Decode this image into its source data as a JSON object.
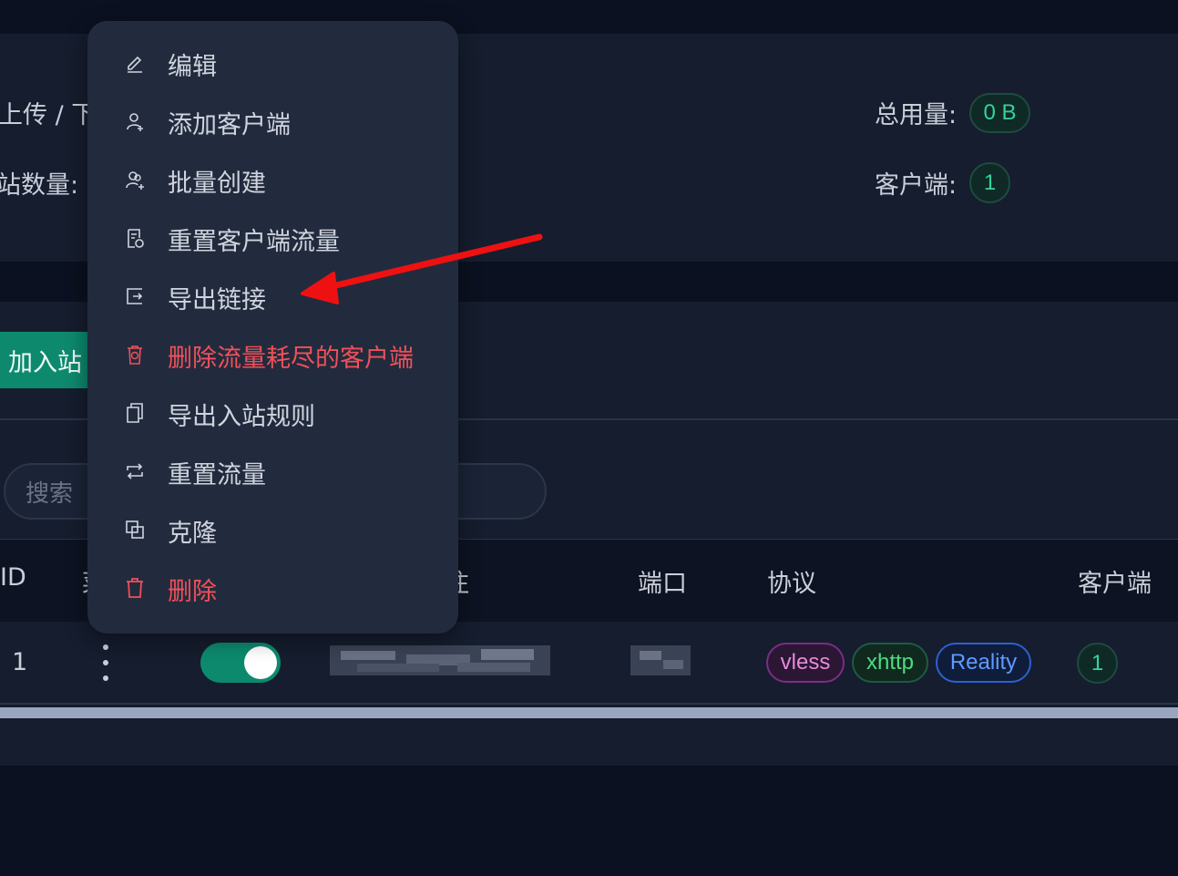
{
  "stats": {
    "upload_download_label": "上传 / 下",
    "inbound_count_label": "站数量:",
    "total_usage_label": "总用量:",
    "total_usage_value": "0 B",
    "clients_label": "客户端:",
    "clients_value": "1"
  },
  "toolbar": {
    "add_inbound_label": "加入站",
    "search_placeholder": "搜索"
  },
  "table": {
    "headers": {
      "id": "ID",
      "menu": "菜",
      "remark": "注",
      "port": "端口",
      "protocol": "协议",
      "clients": "客户端"
    },
    "rows": [
      {
        "id": "1",
        "enabled": true,
        "tags": [
          "vless",
          "xhttp",
          "Reality"
        ],
        "clients": "1"
      }
    ]
  },
  "context_menu": {
    "items": [
      {
        "label": "编辑",
        "icon": "edit-icon",
        "danger": false
      },
      {
        "label": "添加客户端",
        "icon": "user-add-icon",
        "danger": false
      },
      {
        "label": "批量创建",
        "icon": "users-add-icon",
        "danger": false
      },
      {
        "label": "重置客户端流量",
        "icon": "file-reset-icon",
        "danger": false
      },
      {
        "label": "导出链接",
        "icon": "export-icon",
        "danger": false
      },
      {
        "label": "删除流量耗尽的客户端",
        "icon": "trash-clock-icon",
        "danger": true
      },
      {
        "label": "导出入站规则",
        "icon": "copy-icon",
        "danger": false
      },
      {
        "label": "重置流量",
        "icon": "retweet-icon",
        "danger": false
      },
      {
        "label": "克隆",
        "icon": "clone-icon",
        "danger": false
      },
      {
        "label": "删除",
        "icon": "trash-icon",
        "danger": true
      }
    ]
  },
  "colors": {
    "accent": "#0d8a6e",
    "danger": "#f0505a",
    "annotation": "#ee1111"
  }
}
